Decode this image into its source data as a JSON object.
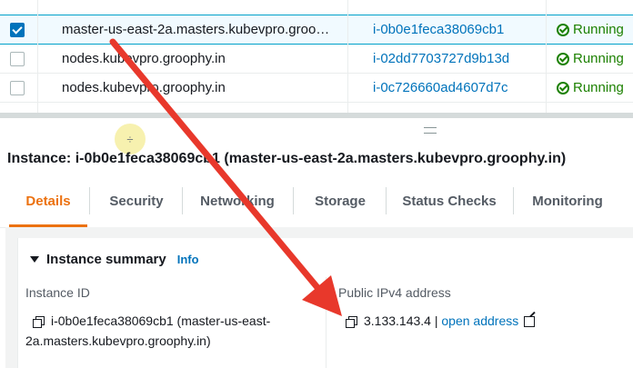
{
  "instances": [
    {
      "name": "master-us-east-2a.masters.kubevpro.groo…",
      "id": "i-0b0e1feca38069cb1",
      "state": "Running",
      "checked": true
    },
    {
      "name": "nodes.kubevpro.groophy.in",
      "id": "i-02dd7703727d9b13d",
      "state": "Running",
      "checked": false
    },
    {
      "name": "nodes.kubevpro.groophy.in",
      "id": "i-0c726660ad4607d7c",
      "state": "Running",
      "checked": false
    }
  ],
  "details": {
    "title": "Instance: i-0b0e1feca38069cb1 (master-us-east-2a.masters.kubevpro.groophy.in)",
    "tabs": [
      "Details",
      "Security",
      "Networking",
      "Storage",
      "Status Checks",
      "Monitoring"
    ],
    "active_tab": "Details",
    "summary_title": "Instance summary",
    "summary_info": "Info",
    "instance_id_label": "Instance ID",
    "instance_id_line1": "i-0b0e1feca38069cb1 (master-us-east-",
    "instance_id_line2": "2a.masters.kubevpro.groophy.in)",
    "ipv4_label": "Public IPv4 address",
    "ipv4_value": "3.133.143.4",
    "ipv4_sep": "|",
    "ipv4_link": "open address"
  },
  "colors": {
    "accent": "#ec7211",
    "link": "#0073bb",
    "running": "#1d8102",
    "annotation_arrow": "#e8382b"
  },
  "icons": [
    "checkbox-icon",
    "success-icon",
    "drag-handle-icon",
    "triangle-down-icon",
    "copy-icon",
    "external-link-icon",
    "cursor-highlight-icon"
  ]
}
